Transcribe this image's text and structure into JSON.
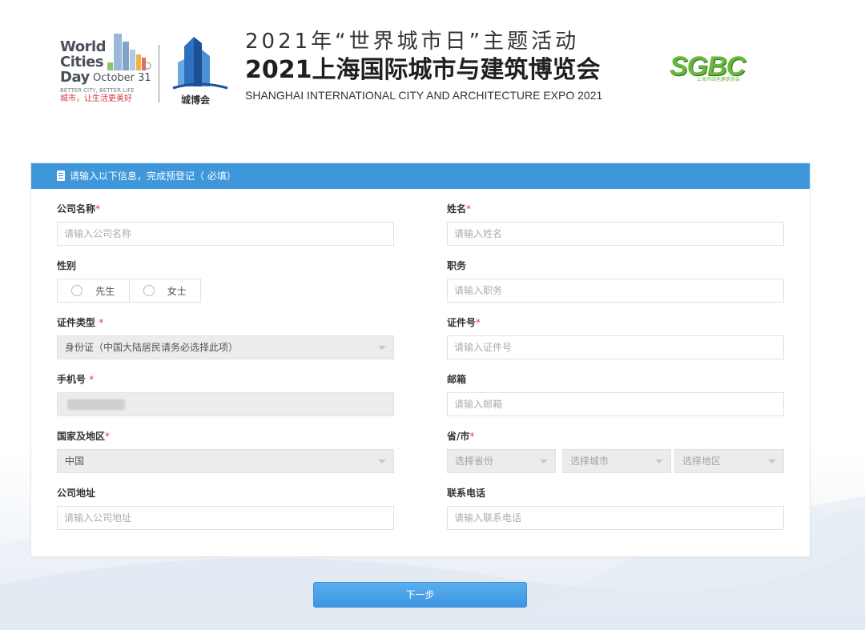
{
  "header": {
    "wcd_logo": {
      "line1": "World",
      "line2": "Cities",
      "line3": "Day",
      "date": "October 31",
      "slogan_en": "BETTER CITY, BETTER LIFE",
      "slogan_cn": "城市，让生活更美好"
    },
    "expo_logo_text": "城博会",
    "title_line1": "2021年“世界城市日”主题活动",
    "title_line2": "2021上海国际城市与建筑博览会",
    "title_line3": "SHANGHAI INTERNATIONAL CITY AND ARCHITECTURE EXPO 2021",
    "sgbc_logo_text": "SGBC",
    "sgbc_sub": "上海市绿色建筑协会"
  },
  "form": {
    "header_text": "请输入以下信息，完成预登记（ 必填）",
    "company_name": {
      "label": "公司名称",
      "required_mark": "*",
      "placeholder": "请输入公司名称"
    },
    "name": {
      "label": "姓名",
      "required_mark": "*",
      "placeholder": "请输入姓名"
    },
    "gender": {
      "label": "性别",
      "options": [
        "先生",
        "女士"
      ]
    },
    "position": {
      "label": "职务",
      "placeholder": "请输入职务"
    },
    "id_type": {
      "label": "证件类型",
      "required_mark": "*",
      "value": "身份证（中国大陆居民请务必选择此项）"
    },
    "id_number": {
      "label": "证件号",
      "required_mark": "*",
      "placeholder": "请输入证件号"
    },
    "mobile": {
      "label": "手机号",
      "required_mark": "*"
    },
    "email": {
      "label": "邮箱",
      "placeholder": "请输入邮箱"
    },
    "country": {
      "label": "国家及地区",
      "required_mark": "*",
      "value": "中国"
    },
    "province_city": {
      "label": "省/市",
      "required_mark": "*",
      "province_placeholder": "选择省份",
      "city_placeholder": "选择城市",
      "district_placeholder": "选择地区"
    },
    "company_address": {
      "label": "公司地址",
      "placeholder": "请输入公司地址"
    },
    "contact_phone": {
      "label": "联系电话",
      "placeholder": "请输入联系电话"
    }
  },
  "next_button_label": "下一步",
  "colors": {
    "accent": "#3e97db",
    "required": "#e5393c",
    "sgbc_green": "#67b83a"
  }
}
